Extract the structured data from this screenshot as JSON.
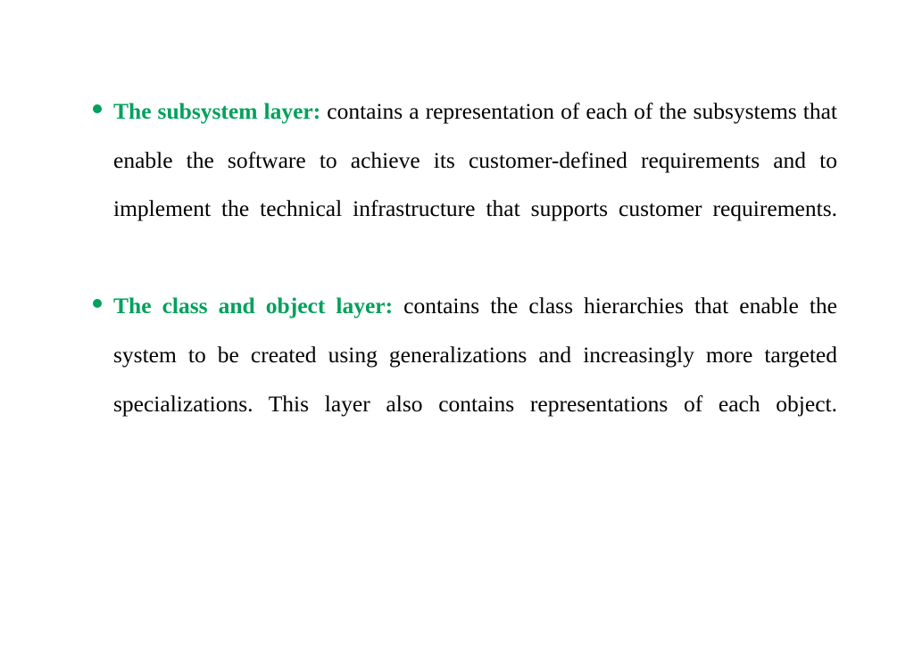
{
  "slide": {
    "background_color": "#ffffff",
    "accent_color": "#00a15c",
    "text_color": "#000000",
    "bullets": [
      {
        "marker": "bullet-dot",
        "label": "The subsystem layer:",
        "body": " contains a representation of each of the subsystems that enable the software to achieve its customer-defined requirements and to implement the technical infrastructure that supports customer requirements."
      },
      {
        "marker": "bullet-dot",
        "label": "The class and object layer:",
        "body": " contains the class hierarchies that enable the system to be created using generalizations and increasingly more targeted specializations. This layer also contains representations of each object."
      }
    ]
  }
}
